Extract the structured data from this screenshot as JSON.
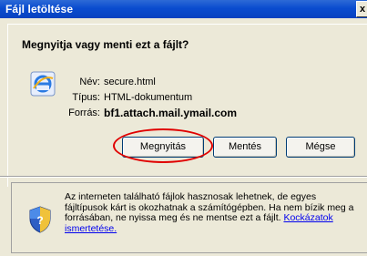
{
  "window": {
    "title": "Fájl letöltése",
    "close_symbol": "x"
  },
  "question": "Megnyitja vagy menti ezt a fájlt?",
  "file": {
    "icon": "ie-icon",
    "name_label": "Név:",
    "name_value": "secure.html",
    "type_label": "Típus:",
    "type_value": "HTML-dokumentum",
    "source_label": "Forrás:",
    "source_value": "bf1.attach.mail.ymail.com"
  },
  "buttons": {
    "open": "Megnyitás",
    "save": "Mentés",
    "cancel": "Mégse"
  },
  "warning": {
    "icon": "shield-question-icon",
    "text": "Az interneten található fájlok hasznosak lehetnek, de egyes fájltípusok kárt is okozhatnak a számítógépben. Ha nem bízik meg a forrásában, ne nyissa meg és ne mentse ezt a fájlt. ",
    "link": "Kockázatok ismertetése."
  },
  "colors": {
    "titlebar": "#0a4ccf",
    "dialog_bg": "#ece9d8",
    "highlight": "#e00000",
    "link": "#0000ee"
  }
}
